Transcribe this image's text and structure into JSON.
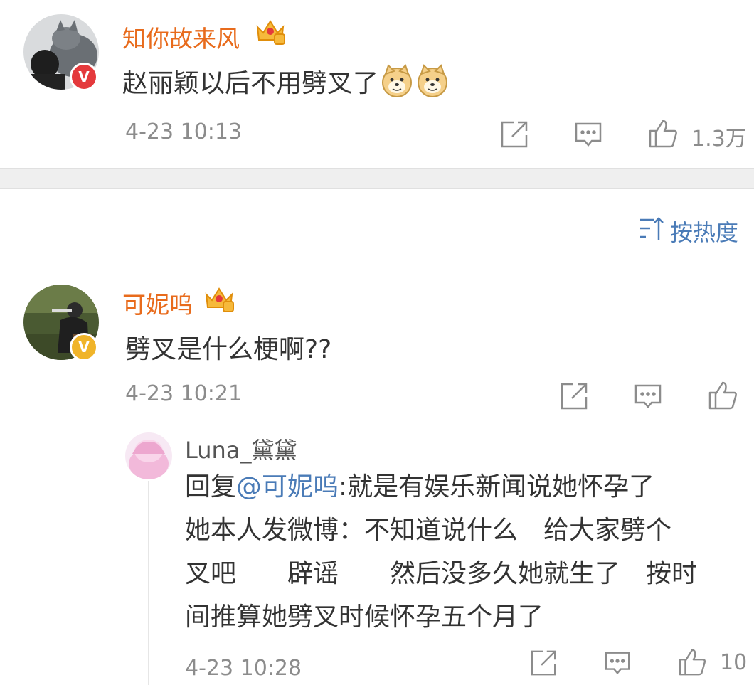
{
  "colors": {
    "username": "#e86b1c",
    "link": "#4a7bb7",
    "meta": "#8c8c8c",
    "separator": "#efefef",
    "badge_red": "#e4393c",
    "badge_gold": "#f0b429"
  },
  "comments": [
    {
      "username": "知你故来风",
      "text": "赵丽颖以后不用劈叉了",
      "emojis": [
        "doge-emoji",
        "doge-emoji"
      ],
      "time": "4-23 10:13",
      "likes": "1.3万",
      "verified_badge": "red-v-badge",
      "member_badge": "crown-badge"
    },
    {
      "username": "可妮呜",
      "text": "劈叉是什么梗啊??",
      "time": "4-23 10:21",
      "likes": "",
      "verified_badge": "gold-v-badge",
      "member_badge": "crown-badge"
    }
  ],
  "sort": {
    "label": "按热度",
    "icon": "sort-icon"
  },
  "reply": {
    "username": "Luna_黛黛",
    "prefix": "回复",
    "mention": "@可妮呜",
    "lines": [
      ":就是有娱乐新闻说她怀孕了",
      "她本人发微博：不知道说什么　给大家劈个",
      "叉吧　　辟谣　　然后没多久她就生了　按时",
      "间推算她劈叉时候怀孕五个月了"
    ],
    "time": "4-23 10:28",
    "likes": "10"
  }
}
